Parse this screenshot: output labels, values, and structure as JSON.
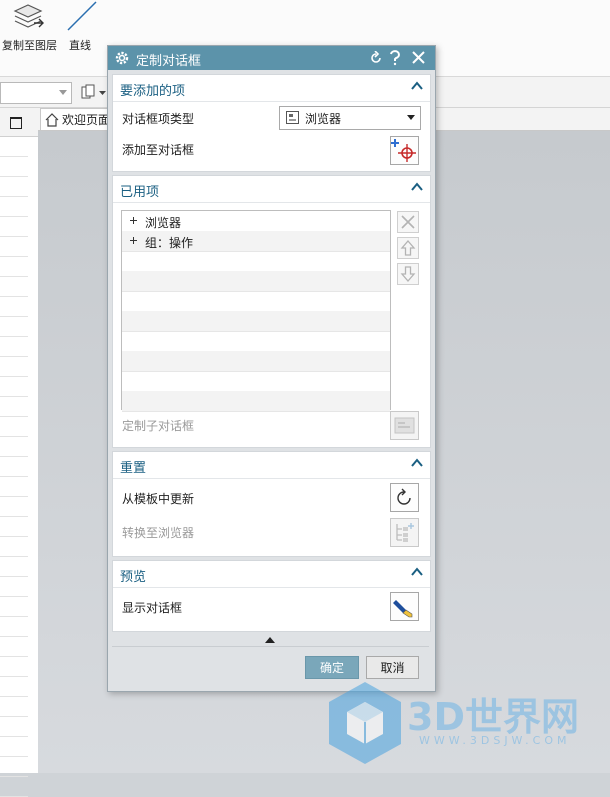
{
  "ribbon": {
    "copy_to_layer_label": "复制至图层",
    "line_label": "直线"
  },
  "tabs": {
    "welcome_label": "欢迎页面"
  },
  "dialog": {
    "title": "定制对话框",
    "groups": {
      "add_items": {
        "title": "要添加的项",
        "item_type_label": "对话框项类型",
        "item_type_value": "浏览器",
        "add_to_dialog_label": "添加至对话框"
      },
      "used_items": {
        "title": "已用项",
        "list": [
          "浏览器",
          "组：操作"
        ],
        "customize_subdialog_label": "定制子对话框"
      },
      "reset": {
        "title": "重置",
        "update_from_template_label": "从模板中更新",
        "convert_to_browser_label": "转换至浏览器"
      },
      "preview": {
        "title": "预览",
        "show_dialog_label": "显示对话框"
      }
    },
    "ok_label": "确定",
    "cancel_label": "取消"
  },
  "watermark": {
    "brand": "3D世界网",
    "url": "WWW.3DSJW.COM"
  },
  "colors": {
    "title_bar": "#5c93aa",
    "group_title": "#1a5f82",
    "ok_button": "#7aa7ba"
  }
}
